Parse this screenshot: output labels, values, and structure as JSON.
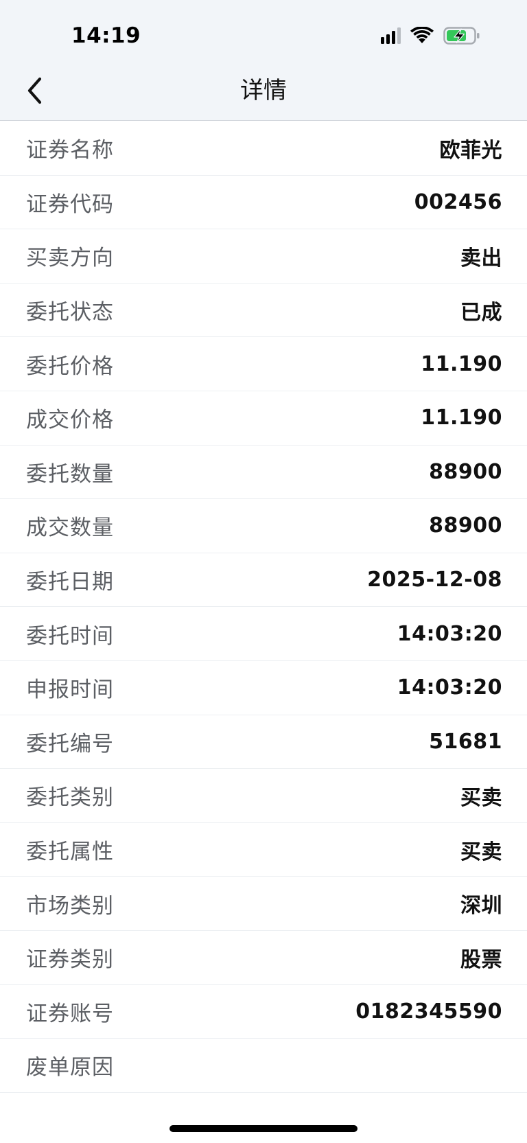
{
  "status_bar": {
    "time": "14:19",
    "signal_icon": "cellular-signal-icon",
    "wifi_icon": "wifi-icon",
    "battery_icon": "battery-charging-icon",
    "battery_color": "#34c759"
  },
  "nav": {
    "back_icon": "chevron-left-icon",
    "title": "详情"
  },
  "details": [
    {
      "label": "证券名称",
      "value": "欧菲光"
    },
    {
      "label": "证券代码",
      "value": "002456"
    },
    {
      "label": "买卖方向",
      "value": "卖出"
    },
    {
      "label": "委托状态",
      "value": "已成"
    },
    {
      "label": "委托价格",
      "value": "11.190"
    },
    {
      "label": "成交价格",
      "value": "11.190"
    },
    {
      "label": "委托数量",
      "value": "88900"
    },
    {
      "label": "成交数量",
      "value": "88900"
    },
    {
      "label": "委托日期",
      "value": "2025-12-08"
    },
    {
      "label": "委托时间",
      "value": "14:03:20"
    },
    {
      "label": "申报时间",
      "value": "14:03:20"
    },
    {
      "label": "委托编号",
      "value": "51681"
    },
    {
      "label": "委托类别",
      "value": "买卖"
    },
    {
      "label": "委托属性",
      "value": "买卖"
    },
    {
      "label": "市场类别",
      "value": "深圳"
    },
    {
      "label": "证券类别",
      "value": "股票"
    },
    {
      "label": "证券账号",
      "value": "0182345590"
    },
    {
      "label": "废单原因",
      "value": ""
    }
  ]
}
